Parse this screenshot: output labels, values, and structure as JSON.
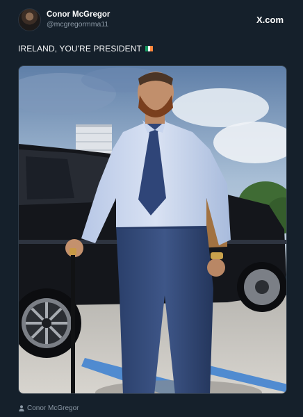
{
  "account": {
    "display_name": "Conor McGregor",
    "handle": "@mcgregormma11",
    "avatar_icon": "profile-photo"
  },
  "brand": {
    "label": "X.com",
    "icon": "x-logo-icon"
  },
  "tweet": {
    "text": "IRELAND, YOU'RE PRESIDENT",
    "emoji": "flag-ireland",
    "flag_colors": [
      "#169b62",
      "#ffffff",
      "#ff883e"
    ]
  },
  "media": {
    "icon": "photo-man-in-suit-with-cane"
  },
  "footer": {
    "icon": "person-icon",
    "author": "Conor McGregor"
  },
  "colors": {
    "background": "#15202b",
    "primary_text": "#e7e9ea",
    "secondary_text": "#8b98a5"
  }
}
